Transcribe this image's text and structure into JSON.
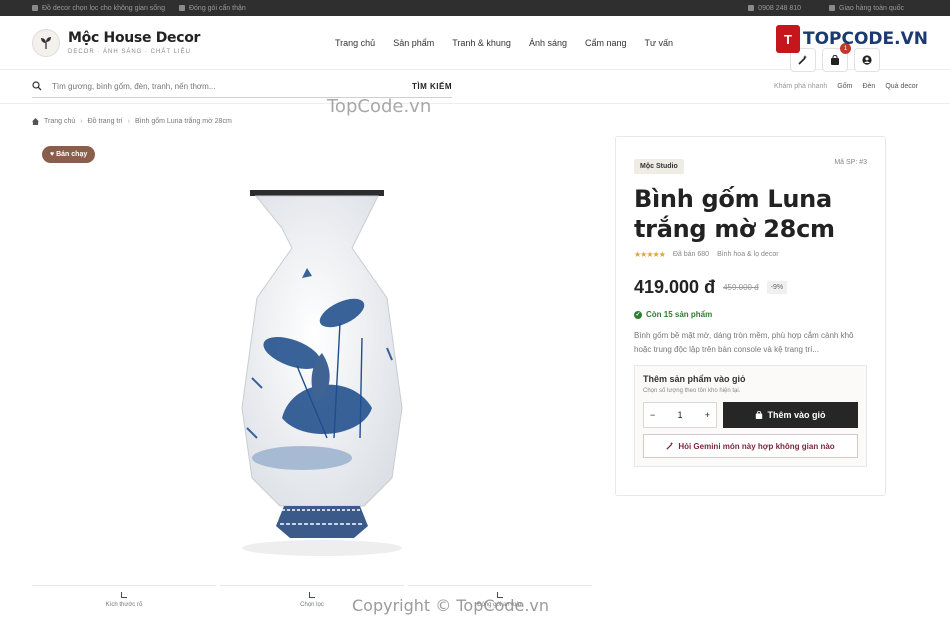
{
  "topbar": {
    "left": [
      "Đồ decor chọn lọc cho không gian sống",
      "Đóng gói cẩn thận"
    ],
    "right": [
      "0908 248 810",
      "Giao hàng toàn quốc"
    ]
  },
  "brand": {
    "name": "Mộc House Decor",
    "tagline": "DECOR · ÁNH SÁNG · CHẤT LIỆU"
  },
  "nav": [
    "Trang chủ",
    "Sản phẩm",
    "Tranh & khung",
    "Ánh sáng",
    "Cẩm nang",
    "Tư vấn"
  ],
  "header_actions": {
    "cart_count": "1",
    "icons": [
      "magic-wand-icon",
      "bag-icon",
      "user-icon"
    ]
  },
  "watermark": {
    "logo_text": "TOPCODE.VN",
    "center_text": "TopCode.vn",
    "copyright": "Copyright © TopCode.vn"
  },
  "search": {
    "placeholder": "Tìm gương, bình gốm, đèn, tranh, nến thơm...",
    "button": "TÌM KIẾM",
    "quick_label": "Khám phá nhanh",
    "quick_links": [
      "Gốm",
      "Đèn",
      "Quà decor"
    ]
  },
  "breadcrumb": [
    "Trang chủ",
    "Đồ trang trí",
    "Bình gốm Luna trắng mờ 28cm"
  ],
  "gallery": {
    "badge": "Bán chạy"
  },
  "features": [
    "Kích thước rõ",
    "Chọn lọc",
    "Đóng gói an toàn"
  ],
  "product": {
    "studio": "Mộc Studio",
    "sku": "Mã SP: #3",
    "title": "Bình gốm Luna trắng mờ 28cm",
    "rating": 5,
    "sold": "Đã bán 680",
    "category": "Bình hoa & lọ decor",
    "price": "419.000 đ",
    "old_price": "459.000 đ",
    "discount": "-9%",
    "stock": "Còn 15 sản phẩm",
    "description": "Bình gốm bề mặt mờ, dáng tròn mềm, phù hợp cắm cành khô hoặc trung độc lập trên bàn console và kệ trang trí..."
  },
  "cart": {
    "title": "Thêm sản phẩm vào giỏ",
    "subtitle": "Chọn số lượng theo tồn kho hiện tại.",
    "quantity": "1",
    "minus": "−",
    "plus": "+",
    "add_button": "Thêm vào giỏ",
    "gemini_button": "Hỏi Gemini món này hợp không gian nào"
  }
}
